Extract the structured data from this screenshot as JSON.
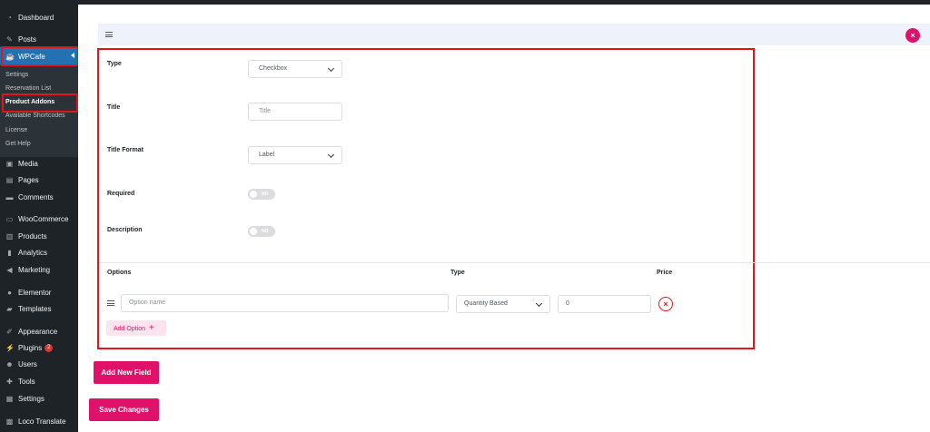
{
  "sidebar": {
    "items": [
      {
        "label": "Dashboard",
        "icon": "dashboard-icon"
      },
      {
        "label": "Posts",
        "icon": "pin-icon"
      },
      {
        "label": "WPCafe",
        "icon": "wpcafe-icon"
      },
      {
        "label": "Media",
        "icon": "media-icon"
      },
      {
        "label": "Pages",
        "icon": "pages-icon"
      },
      {
        "label": "Comments",
        "icon": "comments-icon"
      },
      {
        "label": "WooCommerce",
        "icon": "woocommerce-icon"
      },
      {
        "label": "Products",
        "icon": "products-icon"
      },
      {
        "label": "Analytics",
        "icon": "analytics-icon"
      },
      {
        "label": "Marketing",
        "icon": "megaphone-icon"
      },
      {
        "label": "Elementor",
        "icon": "elementor-icon"
      },
      {
        "label": "Templates",
        "icon": "folder-icon"
      },
      {
        "label": "Appearance",
        "icon": "brush-icon"
      },
      {
        "label": "Plugins",
        "icon": "plug-icon",
        "badge": "2"
      },
      {
        "label": "Users",
        "icon": "user-icon"
      },
      {
        "label": "Tools",
        "icon": "wrench-icon"
      },
      {
        "label": "Settings",
        "icon": "settings-icon"
      },
      {
        "label": "Loco Translate",
        "icon": "translate-icon"
      }
    ],
    "submenu": [
      "Settings",
      "Reservation List",
      "Product Addons",
      "Available Shortcodes",
      "License",
      "Get Help"
    ]
  },
  "form": {
    "type_label": "Type",
    "type_value": "Checkbox",
    "title_label": "Title",
    "title_placeholder": "Title",
    "title_format_label": "Title Format",
    "title_format_value": "Label",
    "required_label": "Required",
    "required_toggle": "NO",
    "description_label": "Description",
    "description_toggle": "NO"
  },
  "options": {
    "col_options": "Options",
    "col_type": "Type",
    "col_price": "Price",
    "row": {
      "name_placeholder": "Option name",
      "type_value": "Quantity Based",
      "price_value": "0"
    },
    "add_option_label": "Add Option",
    "add_option_icon": "+"
  },
  "buttons": {
    "add_new_field": "Add New Field",
    "save_changes": "Save Changes"
  },
  "colors": {
    "accent": "#e01168",
    "highlight": "#e4141b",
    "sidebar_bg": "#1d2327",
    "active_menu": "#2271b1"
  }
}
